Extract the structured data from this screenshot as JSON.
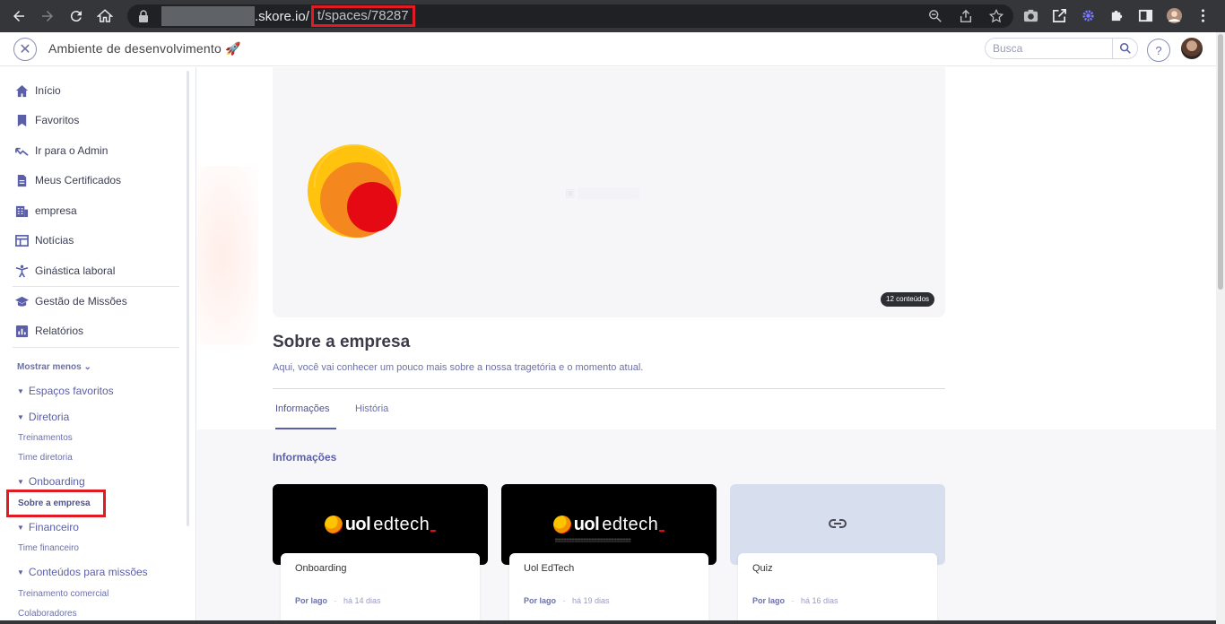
{
  "browser": {
    "url_domain": ".skore.io/",
    "url_path": "t/spaces/78287"
  },
  "header": {
    "env_title": "Ambiente de desenvolvimento 🚀",
    "search_placeholder": "Busca",
    "help": "?"
  },
  "sidebar": {
    "items": [
      {
        "label": "Início",
        "icon": "home-icon"
      },
      {
        "label": "Favoritos",
        "icon": "bookmark-icon"
      },
      {
        "label": "Ir para o Admin",
        "icon": "admin-icon"
      },
      {
        "label": "Meus Certificados",
        "icon": "certificate-icon"
      },
      {
        "label": "empresa",
        "icon": "building-icon"
      },
      {
        "label": "Notícias",
        "icon": "news-icon"
      },
      {
        "label": "Ginástica laboral",
        "icon": "exercise-icon"
      },
      {
        "label": "Gestão de Missões",
        "icon": "graduation-icon"
      },
      {
        "label": "Relatórios",
        "icon": "report-icon"
      }
    ],
    "show_less": "Mostrar menos",
    "tree": {
      "favorites": "Espaços favoritos",
      "diretoria": "Diretoria",
      "diretoria_items": [
        "Treinamentos",
        "Time diretoria"
      ],
      "onboarding": "Onboarding",
      "onboarding_active": "Sobre a empresa",
      "financeiro": "Financeiro",
      "financeiro_items": [
        "Time financeiro"
      ],
      "missoes": "Conteúdos para missões",
      "missoes_items": [
        "Treinamento comercial",
        "Colaboradores"
      ]
    }
  },
  "main": {
    "hero_badge": "12 conteúdos",
    "title": "Sobre a empresa",
    "subtitle": "Aqui, você vai conhecer um pouco mais sobre a nossa tragetória e o momento atual.",
    "tabs": [
      "Informações",
      "História"
    ],
    "section_title": "Informações",
    "cards": [
      {
        "title": "Onboarding",
        "author": "Por lago",
        "time": "há 14 dias",
        "brand_uol": "uol",
        "brand_ed": "edtech"
      },
      {
        "title": "Uol EdTech",
        "author": "Por lago",
        "time": "há 19 dias",
        "brand_uol": "uol",
        "brand_ed": "edtech"
      },
      {
        "title": "Quiz",
        "author": "Por lago",
        "time": "há 16 dias"
      }
    ]
  },
  "colors": {
    "accent": "#5a5fa8",
    "highlight": "#e01b24"
  }
}
